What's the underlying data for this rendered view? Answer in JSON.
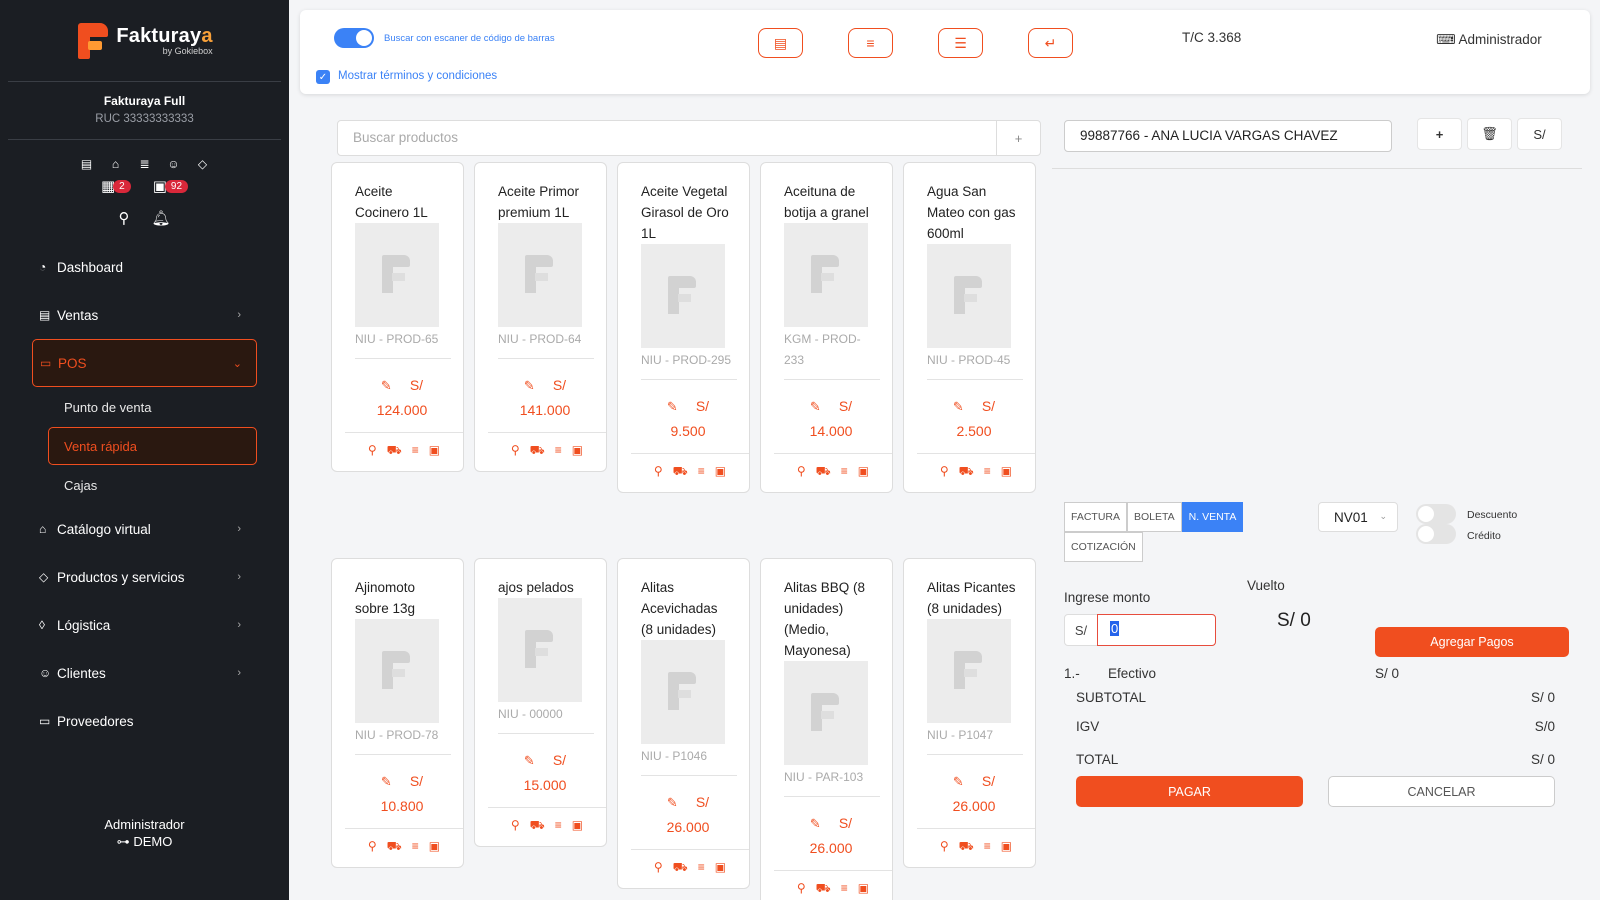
{
  "brand": {
    "name_main": "Fakturay",
    "name_accent": "a",
    "sub": "by Gokiebox",
    "color": "#f04e1f"
  },
  "company": {
    "name": "Fakturaya Full",
    "ruc": "RUC 33333333333"
  },
  "badges": {
    "agenda_count": "2",
    "orders_count": "92"
  },
  "sidebar": {
    "items": [
      {
        "label": "Dashboard",
        "icon": "dashboard-icon"
      },
      {
        "label": "Ventas",
        "icon": "receipt-icon"
      },
      {
        "label": "POS",
        "icon": "monitor-icon"
      },
      {
        "label": "Catálogo virtual",
        "icon": "store-icon"
      },
      {
        "label": "Productos y servicios",
        "icon": "box-icon"
      },
      {
        "label": "Lógistica",
        "icon": "tag-icon"
      },
      {
        "label": "Clientes",
        "icon": "users-icon"
      },
      {
        "label": "Proveedores",
        "icon": "briefcase-icon"
      }
    ],
    "pos_sub": [
      "Punto de venta",
      "Venta rápida",
      "Cajas"
    ],
    "footer_user": "Administrador",
    "footer_mode": "DEMO"
  },
  "topbar": {
    "scanner_label": "Buscar con escaner de código de barras",
    "terms_label": "Mostrar términos y condiciones",
    "exchange_rate": "T/C 3.368",
    "user": "Administrador"
  },
  "search": {
    "placeholder": "Buscar productos",
    "add": "+"
  },
  "products": [
    {
      "name": "Aceite Cocinero 1L",
      "code": "NIU - PROD-65",
      "currency": "S/",
      "price": "124.000"
    },
    {
      "name": "Aceite Primor premium 1L",
      "code": "NIU - PROD-64",
      "currency": "S/",
      "price": "141.000"
    },
    {
      "name": "Aceite Vegetal Girasol de Oro 1L",
      "code": "NIU - PROD-295",
      "currency": "S/",
      "price": "9.500"
    },
    {
      "name": "Aceituna de botija a granel",
      "code": "KGM - PROD-233",
      "currency": "S/",
      "price": "14.000"
    },
    {
      "name": "Agua San Mateo con gas 600ml",
      "code": "NIU - PROD-45",
      "currency": "S/",
      "price": "2.500"
    },
    {
      "name": "Ajinomoto sobre 13g",
      "code": "NIU - PROD-78",
      "currency": "S/",
      "price": "10.800"
    },
    {
      "name": "ajos pelados",
      "code": "NIU - 00000",
      "currency": "S/",
      "price": "15.000"
    },
    {
      "name": "Alitas Acevichadas (8 unidades)",
      "code": "NIU - P1046",
      "currency": "S/",
      "price": "26.000"
    },
    {
      "name": "Alitas BBQ (8 unidades) (Medio, Mayonesa)",
      "code": "NIU - PAR-103",
      "currency": "S/",
      "price": "26.000"
    },
    {
      "name": "Alitas Picantes (8 unidades)",
      "code": "NIU - P1047",
      "currency": "S/",
      "price": "26.000"
    }
  ],
  "panel": {
    "client": "99887766 - ANA LUCIA VARGAS CHAVEZ",
    "btn_add": "+",
    "btn_currency": "S/",
    "doc_types": [
      "FACTURA",
      "BOLETA",
      "N. VENTA"
    ],
    "doc_type_extra": "COTIZACIÓN",
    "series": "NV01",
    "discount_label": "Descuento",
    "credit_label": "Crédito",
    "vuelto_label": "Vuelto",
    "amount_label": "Ingrese monto",
    "currency": "S/",
    "amount_value": "0",
    "vuelto_value": "S/ 0",
    "add_payments": "Agregar Pagos",
    "payment_index": "1.-",
    "payment_method": "Efectivo",
    "payment_amount": "S/ 0",
    "subtotal_label": "SUBTOTAL",
    "subtotal_value": "S/ 0",
    "igv_label": "IGV",
    "igv_value": "S/0",
    "total_label": "TOTAL",
    "total_value": "S/ 0",
    "pay": "PAGAR",
    "cancel": "CANCELAR"
  }
}
